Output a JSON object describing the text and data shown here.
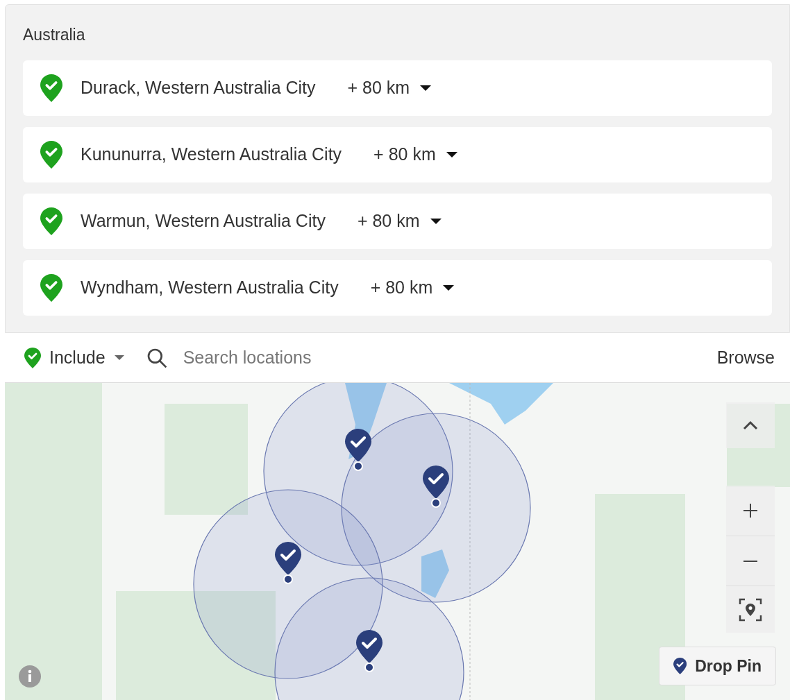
{
  "region": "Australia",
  "locations": [
    {
      "name": "Durack, Western Australia City",
      "radius": "+ 80 km"
    },
    {
      "name": "Kununurra, Western Australia City",
      "radius": "+ 80 km"
    },
    {
      "name": "Warmun, Western Australia City",
      "radius": "+ 80 km"
    },
    {
      "name": "Wyndham, Western Australia City",
      "radius": "+ 80 km"
    }
  ],
  "toolbar": {
    "mode": "Include",
    "search": {
      "placeholder": "Search locations"
    },
    "browse": "Browse"
  },
  "map": {
    "drop_pin": "Drop Pin"
  }
}
